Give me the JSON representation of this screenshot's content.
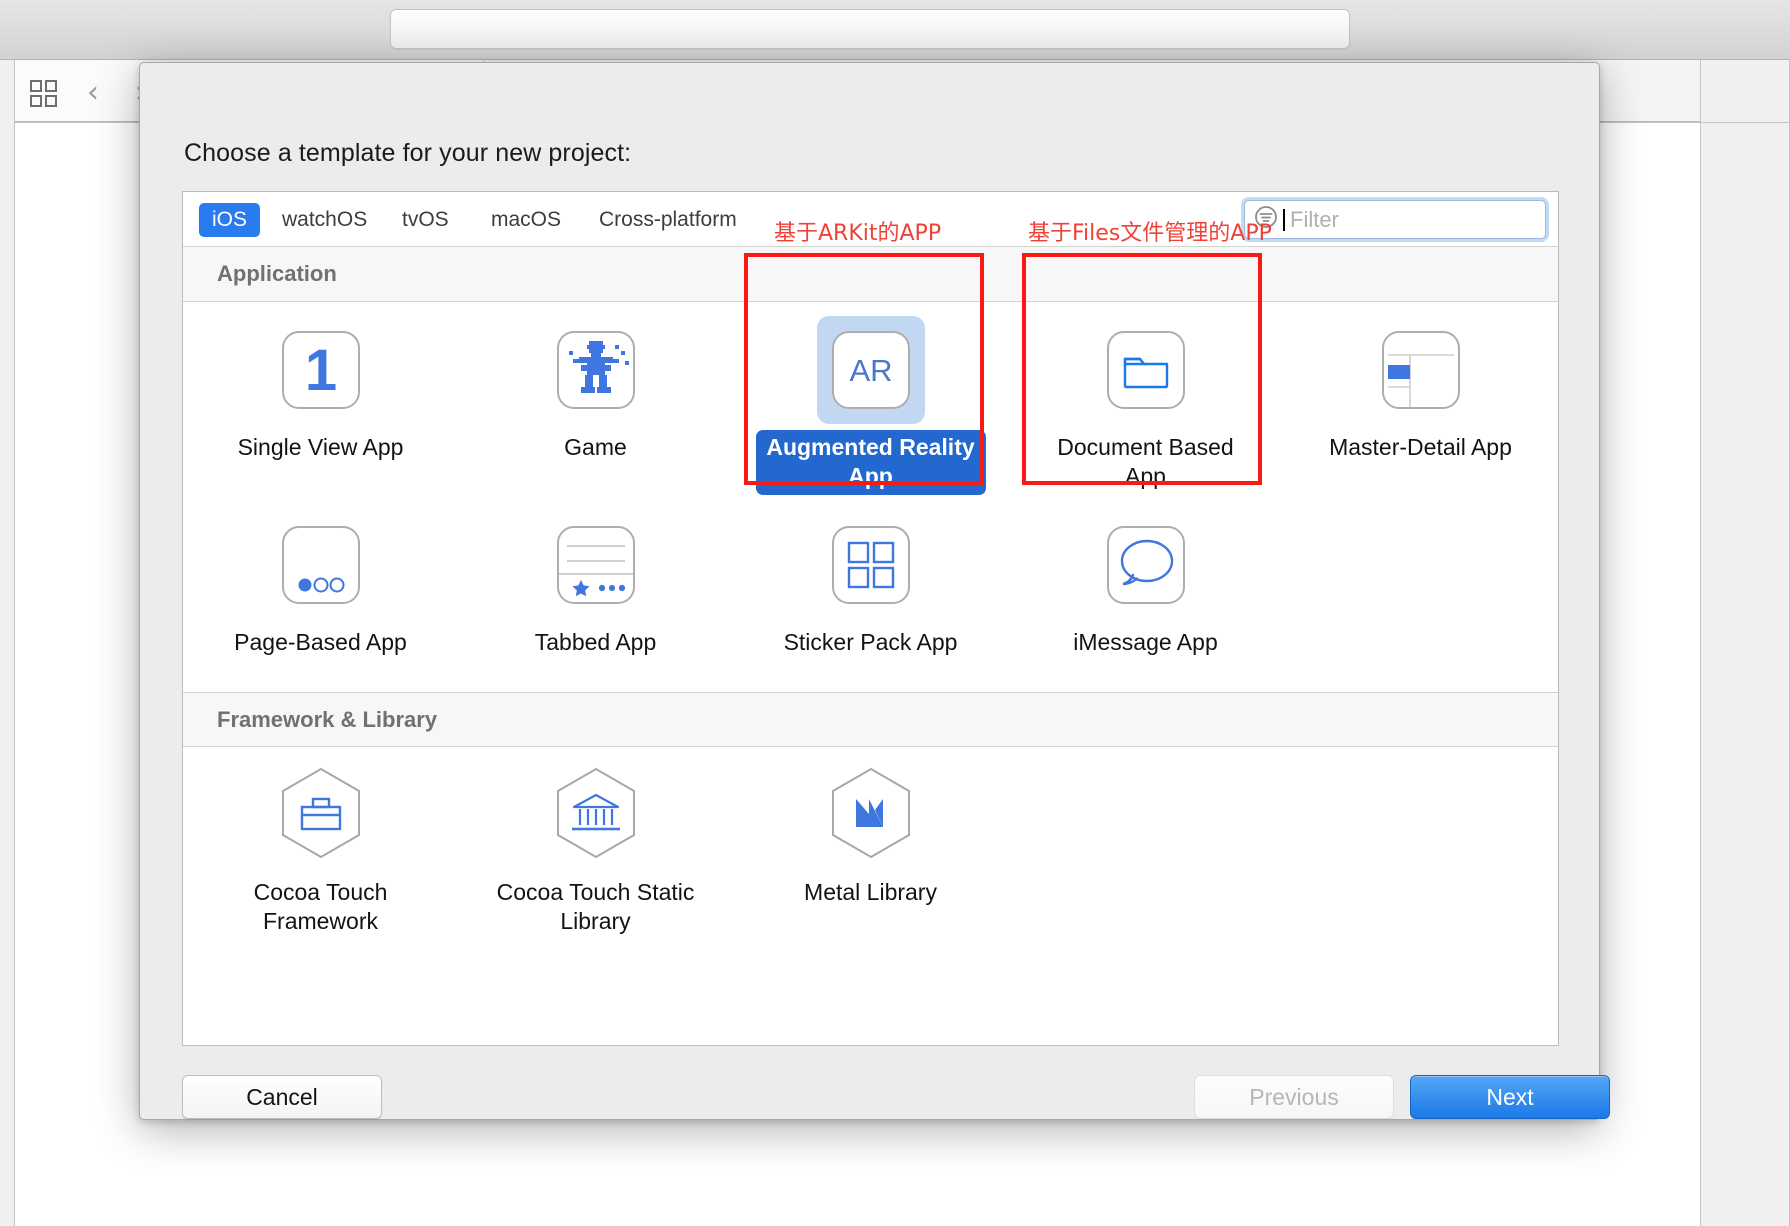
{
  "background_window": {
    "grid_icon": "grid-panels-icon",
    "back_icon": "chevron-left-icon",
    "forward_icon": "chevron-right-icon",
    "activity_bar_text": ""
  },
  "dialog": {
    "title": "Choose a template for your new project:",
    "platform_tabs": [
      {
        "label": "iOS",
        "selected": true
      },
      {
        "label": "watchOS",
        "selected": false
      },
      {
        "label": "tvOS",
        "selected": false
      },
      {
        "label": "macOS",
        "selected": false
      },
      {
        "label": "Cross-platform",
        "selected": false
      }
    ],
    "filter": {
      "placeholder": "Filter",
      "value": "",
      "icon": "filter-circle-icon"
    },
    "sections": [
      {
        "header": "Application",
        "templates": [
          {
            "label": "Single View App",
            "icon": "number-one-icon",
            "selected": false
          },
          {
            "label": "Game",
            "icon": "game-sprite-icon",
            "selected": false
          },
          {
            "label": "Augmented Reality App",
            "icon": "ar-icon",
            "selected": true
          },
          {
            "label": "Document Based App",
            "icon": "folder-icon",
            "selected": false
          },
          {
            "label": "Master-Detail App",
            "icon": "split-view-icon",
            "selected": false
          },
          {
            "label": "Page-Based App",
            "icon": "page-dots-icon",
            "selected": false
          },
          {
            "label": "Tabbed App",
            "icon": "tab-bar-icon",
            "selected": false
          },
          {
            "label": "Sticker Pack App",
            "icon": "grid-four-icon",
            "selected": false
          },
          {
            "label": "iMessage App",
            "icon": "speech-bubble-icon",
            "selected": false
          }
        ]
      },
      {
        "header": "Framework & Library",
        "templates": [
          {
            "label": "Cocoa Touch Framework",
            "icon": "briefcase-hex-icon",
            "selected": false
          },
          {
            "label": "Cocoa Touch Static Library",
            "icon": "bank-hex-icon",
            "selected": false
          },
          {
            "label": "Metal Library",
            "icon": "metal-hex-icon",
            "selected": false
          }
        ]
      }
    ],
    "annotations": [
      {
        "text": "基于ARKit的APP",
        "target": "Augmented Reality App"
      },
      {
        "text": "基于Files文件管理的APP",
        "target": "Document Based App"
      }
    ],
    "buttons": {
      "cancel": "Cancel",
      "previous": "Previous",
      "next": "Next"
    }
  },
  "colors": {
    "accent_blue": "#2a7bf0",
    "selected_label_blue": "#2368cf",
    "selected_icon_bg": "#c2d8f2",
    "annotation_red": "#ef4237",
    "annotation_box_red": "#f71b14",
    "icon_blue": "#3f76e0"
  }
}
